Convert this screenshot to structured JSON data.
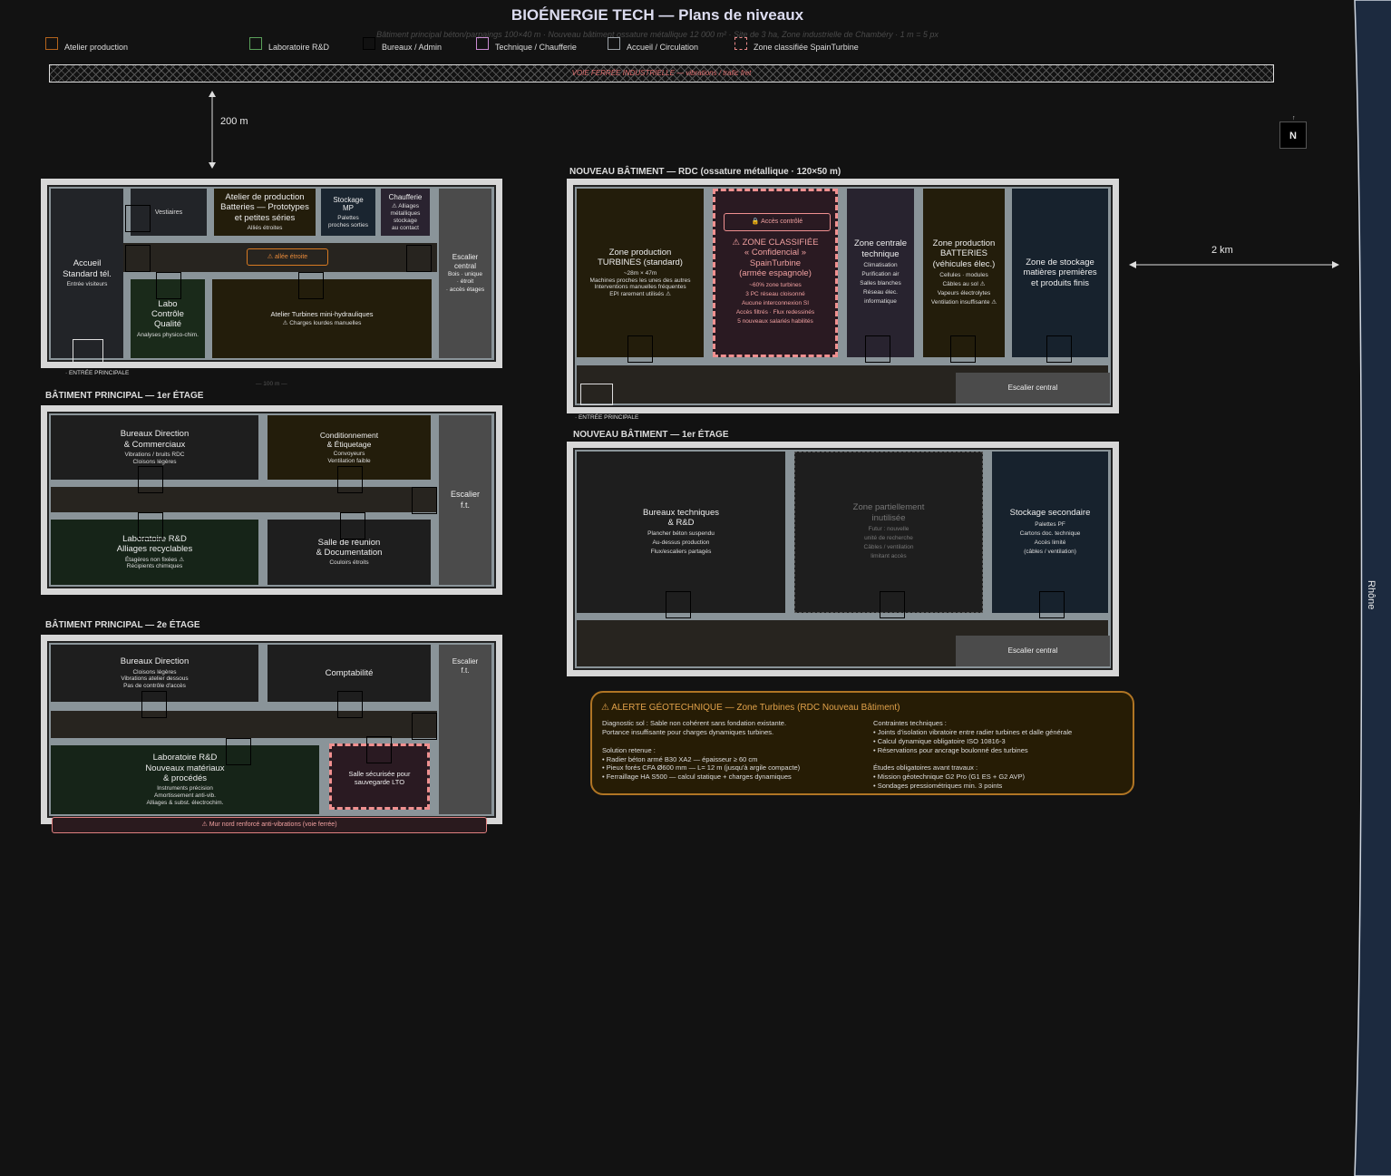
{
  "header": {
    "title": "BIOÉNERGIE TECH — Plans de niveaux",
    "subtitle": "Bâtiment principal béton/parpaings 100×40 m · Nouveau bâtiment ossature métallique 12 000 m² · Site de 3 ha, Zone industrielle de Chambéry · 1 m = 5 px"
  },
  "legend": [
    {
      "label": "Atelier production",
      "color": "#b3631c"
    },
    {
      "label": "Laboratoire R&D",
      "color": "#5aa05a"
    },
    {
      "label": "Bureaux / Admin",
      "color": "#111111"
    },
    {
      "label": "Technique / Chaufferie",
      "color": "#c88ad0"
    },
    {
      "label": "Accueil / Circulation",
      "color": "#9aa0a6"
    },
    {
      "label": "Zone classifiée SpainTurbine",
      "color": "#e88888"
    }
  ],
  "site": {
    "rail": "VOIE FERRÉE INDUSTRIELLE — vibrations / trafic fret",
    "dist_200": "200 m",
    "dist_2km": "2 km",
    "north": "N",
    "river": "Rhône",
    "scale_100": "— 100 m —"
  },
  "main_rdc": {
    "accueil": {
      "t": "Accueil\nStandard tél.",
      "s": "Entrée visiteurs"
    },
    "vestiaires": "Vestiaires",
    "atelier_batt": {
      "t": "Atelier de production\nBatteries — Prototypes\net petites séries",
      "s": "Alliés étroites"
    },
    "stockage_mp": {
      "t": "Stockage\nMP",
      "s": "Palettes\nproches sorties"
    },
    "chaufferie": {
      "t": "Chaufferie",
      "s": "⚠ Alliages\nmétalliques\nstockage\nau contact"
    },
    "escalier": {
      "t": "Escalier\ncentral",
      "s": "Bois · unique\n· étroit\n· accès étages"
    },
    "allee": "⚠ allée étroite",
    "labo_cq": {
      "t": "Labo\nContrôle\nQualité",
      "s": "Analyses physico-chim."
    },
    "atelier_turb": {
      "t": "Atelier Turbines mini-hydrauliques",
      "s": "⚠ Charges lourdes manuelles"
    },
    "entree": "· ENTRÉE PRINCIPALE"
  },
  "main_1": {
    "label": "BÂTIMENT PRINCIPAL — 1er ÉTAGE",
    "bureaux": {
      "t": "Bureaux Direction\n& Commerciaux",
      "s": "Vibrations / bruits RDC\nCloisons légères"
    },
    "condit": {
      "t": "Conditionnement\n& Étiquetage",
      "s": "Convoyeurs\nVentilation faible"
    },
    "labo": {
      "t": "Laboratoire R&D\nAlliages recyclables",
      "s": "Étagères non fixées ⚠\nRécipients chimiques"
    },
    "salle": {
      "t": "Salle de réunion\n& Documentation",
      "s": "Couloirs étroits"
    },
    "escalier": "Escalier\nf.t."
  },
  "main_2": {
    "label": "BÂTIMENT PRINCIPAL — 2e ÉTAGE",
    "bureaux": {
      "t": "Bureaux Direction",
      "s": "Cloisons légères\nVibrations atelier dessous\nPas de contrôle d'accès"
    },
    "compta": "Comptabilité",
    "labo": {
      "t": "Laboratoire R&D\nNouveaux matériaux\n& procédés",
      "s": "Instruments précision\nAmortissement anti-vib.\nAlliages & subst. électrochim."
    },
    "salle_sec": "Salle sécurisée pour\nsauvegarde LTO",
    "escalier": "Escalier\nf.t.",
    "mur": "⚠ Mur nord renforcé anti-vibrations (voie ferrée)"
  },
  "new_rdc": {
    "label": "NOUVEAU BÂTIMENT — RDC (ossature métallique · 120×50 m)",
    "turbines": {
      "t": "Zone production\nTURBINES (standard)",
      "s": "~28m × 47m\nMachines proches les unes des autres\nInterventions manuelles fréquentes\nEPI rarement utilisés ⚠"
    },
    "acces": "🔒 Accès contrôlé",
    "classif": {
      "t": "⚠ ZONE CLASSIFIÉE\n« Confidencial »\nSpainTurbine\n(armée espagnole)",
      "s": "~60% zone turbines\n3 PC réseau cloisonné\nAucune interconnexion SI\nAccès filtrés · Flux redessinés\n5 nouveaux salariés habilités"
    },
    "technique": {
      "t": "Zone centrale\ntechnique",
      "s": "Climatisation\nPurification air\nSalles blanches\nRéseau élec.\ninformatique"
    },
    "batteries": {
      "t": "Zone production\nBATTERIES\n(véhicules élec.)",
      "s": "Cellules · modules\nCâbles au sol ⚠\nVapeurs électrolytes\nVentilation insuffisante ⚠"
    },
    "stockage": {
      "t": "Zone de stockage\nmatières premières\net produits finis"
    },
    "escalier": "Escalier central",
    "entree": "· ENTRÉE PRINCIPALE"
  },
  "new_1": {
    "label": "NOUVEAU BÂTIMENT — 1er ÉTAGE",
    "bureaux": {
      "t": "Bureaux techniques\n& R&D",
      "s": "Plancher béton suspendu\nAu-dessus production\nFlux/escaliers partagés"
    },
    "partielle": {
      "t": "Zone partiellement\ninutilisée",
      "s": "Futur : nouvelle\nunité de recherche\nCâbles / ventilation\nlimitant accès"
    },
    "stockage": {
      "t": "Stockage secondaire",
      "s": "Palettes PF\nCartons doc. technique\nAccès limité\n(câbles / ventilation)"
    },
    "escalier": "Escalier central"
  },
  "alert": {
    "title": "⚠ ALERTE GÉOTECHNIQUE — Zone Turbines (RDC Nouveau Bâtiment)",
    "left": "Diagnostic sol : Sable non cohérent sans fondation existante.\nPortance insuffisante pour charges dynamiques turbines.\n\nSolution retenue :\n •  Radier béton armé B30 XA2 — épaisseur ≥ 60 cm\n •  Pieux forés CFA Ø600 mm — L= 12 m (jusqu'à argile compacte)\n •  Ferraillage HA S500 — calcul statique + charges dynamiques",
    "right": "Contraintes techniques :\n •  Joints d'isolation vibratoire entre radier turbines et dalle générale\n •  Calcul dynamique obligatoire ISO 10816-3\n •  Réservations pour ancrage boulonné des turbines\n\nÉtudes obligatoires avant travaux :\n •  Mission géotechnique G2 Pro (G1 ES + G2 AVP)\n •  Sondages pressiométriques min. 3 points"
  }
}
